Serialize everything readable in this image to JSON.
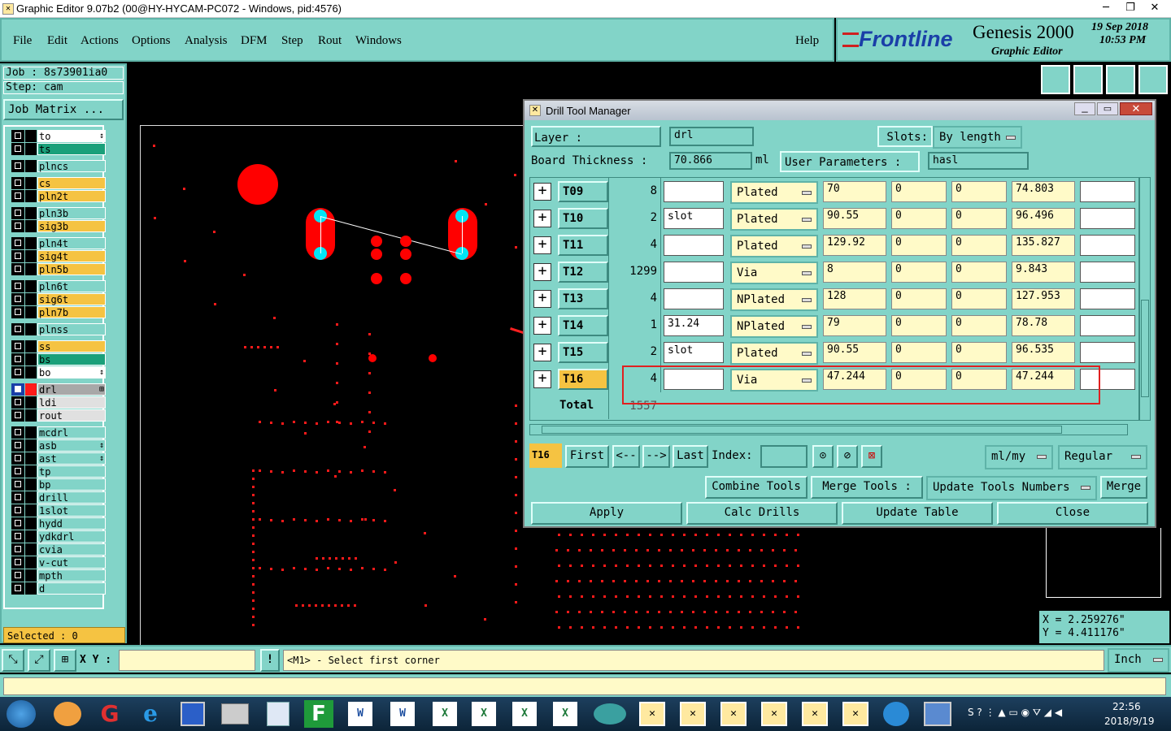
{
  "window": {
    "title": "Graphic Editor 9.07b2 (00@HY-HYCAM-PC072 - Windows, pid:4576)"
  },
  "menu": {
    "items": [
      "File",
      "Edit",
      "Actions",
      "Options",
      "Analysis",
      "DFM",
      "Step",
      "Rout",
      "Windows"
    ],
    "help": "Help"
  },
  "brand": {
    "logo": "Frontline",
    "product": "Genesis 2000",
    "subtitle": "Graphic Editor",
    "date": "19 Sep 2018",
    "time": "10:53 PM"
  },
  "job": {
    "job_label": "Job : 8s73901ia0",
    "step_label": "Step: cam",
    "matrix_button": "Job Matrix ..."
  },
  "layers": [
    {
      "name": "to",
      "color": "white",
      "mark": "↕"
    },
    {
      "name": "ts",
      "color": "#1aa07a"
    },
    {
      "name": "plncs",
      "color": "cyan"
    },
    {
      "name": "cs",
      "color": "#f5c342"
    },
    {
      "name": "pln2t",
      "color": "#f5c342"
    },
    {
      "name": "pln3b",
      "color": "cyan"
    },
    {
      "name": "sig3b",
      "color": "#f5c342"
    },
    {
      "name": "pln4t",
      "color": "cyan"
    },
    {
      "name": "sig4t",
      "color": "#f5c342"
    },
    {
      "name": "pln5b",
      "color": "#f5c342"
    },
    {
      "name": "pln6t",
      "color": "cyan"
    },
    {
      "name": "sig6t",
      "color": "#f5c342"
    },
    {
      "name": "pln7b",
      "color": "#f5c342"
    },
    {
      "name": "plnss",
      "color": "cyan"
    },
    {
      "name": "ss",
      "color": "#f5c342"
    },
    {
      "name": "bs",
      "color": "#1aa07a"
    },
    {
      "name": "bo",
      "color": "white",
      "mark": "↕"
    },
    {
      "name": "drl",
      "color": "#a8a8a8",
      "mark": "⊞"
    },
    {
      "name": "ldi",
      "color": "#e0e0e0"
    },
    {
      "name": "rout",
      "color": "#e0e0e0"
    },
    {
      "name": "mcdrl",
      "color": "cyan"
    },
    {
      "name": "asb",
      "color": "cyan",
      "mark": "↕"
    },
    {
      "name": "ast",
      "color": "cyan",
      "mark": "↕"
    },
    {
      "name": "tp",
      "color": "cyan"
    },
    {
      "name": "bp",
      "color": "cyan"
    },
    {
      "name": "drill",
      "color": "cyan"
    },
    {
      "name": "1slot",
      "color": "cyan"
    },
    {
      "name": "hydd",
      "color": "cyan"
    },
    {
      "name": "ydkdrl",
      "color": "cyan"
    },
    {
      "name": "cvia",
      "color": "cyan"
    },
    {
      "name": "v-cut",
      "color": "cyan"
    },
    {
      "name": "mpth",
      "color": "cyan"
    },
    {
      "name": "d",
      "color": "cyan"
    }
  ],
  "selected_label": "Selected : 0",
  "dialog": {
    "title": "Drill Tool Manager",
    "layer_label": "Layer        :",
    "layer_value": "drl",
    "slots_label": "Slots:",
    "slots_value": "By length",
    "thickness_label": "Board Thickness  :",
    "thickness_value": "70.866",
    "thickness_unit": "ml",
    "user_params_label": "User Parameters :",
    "user_params_value": "hasl",
    "rows": [
      {
        "tool": "T09",
        "count": "8",
        "type_text": "",
        "plating": "Plated",
        "size": "70",
        "c1": "0",
        "c2": "0",
        "finish": "74.803"
      },
      {
        "tool": "T10",
        "count": "2",
        "type_text": "slot",
        "plating": "Plated",
        "size": "90.55",
        "c1": "0",
        "c2": "0",
        "finish": "96.496"
      },
      {
        "tool": "T11",
        "count": "4",
        "type_text": "",
        "plating": "Plated",
        "size": "129.92",
        "c1": "0",
        "c2": "0",
        "finish": "135.827"
      },
      {
        "tool": "T12",
        "count": "1299",
        "type_text": "",
        "plating": "Via",
        "size": "8",
        "c1": "0",
        "c2": "0",
        "finish": "9.843"
      },
      {
        "tool": "T13",
        "count": "4",
        "type_text": "",
        "plating": "NPlated",
        "size": "128",
        "c1": "0",
        "c2": "0",
        "finish": "127.953"
      },
      {
        "tool": "T14",
        "count": "1",
        "type_text": "31.24",
        "plating": "NPlated",
        "size": "79",
        "c1": "0",
        "c2": "0",
        "finish": "78.78"
      },
      {
        "tool": "T15",
        "count": "2",
        "type_text": "slot",
        "plating": "Plated",
        "size": "90.55",
        "c1": "0",
        "c2": "0",
        "finish": "96.535"
      },
      {
        "tool": "T16",
        "count": "4",
        "type_text": "",
        "plating": "Via",
        "size": "47.244",
        "c1": "0",
        "c2": "0",
        "finish": "47.244"
      }
    ],
    "total_label": "Total",
    "total_value": "1557",
    "current_tool": "T16",
    "nav": {
      "first": "First",
      "prev": "<--",
      "next": "-->",
      "last": "Last",
      "index_label": "Index:",
      "units": "ml/my",
      "mode": "Regular"
    },
    "actions": {
      "combine": "Combine Tools",
      "merge_tools": "Merge Tools :",
      "update_numbers": "Update Tools Numbers",
      "merge": "Merge",
      "apply": "Apply",
      "calc": "Calc Drills",
      "update_table": "Update Table",
      "close": "Close"
    }
  },
  "coords": {
    "x": "X = 2.259276\"",
    "y": "Y = 4.411176\""
  },
  "statusbar": {
    "xy_label": "X Y :",
    "message": "<M1> - Select first corner",
    "units": "Inch"
  },
  "taskbar": {
    "time": "22:56",
    "date": "2018/9/19"
  }
}
